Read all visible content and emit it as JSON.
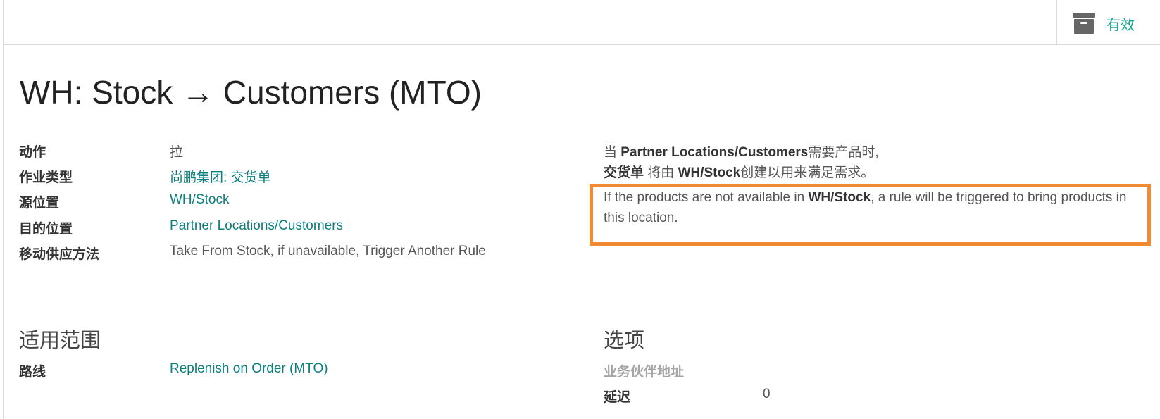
{
  "header": {
    "archive_button_label": "有效"
  },
  "record": {
    "title": "WH: Stock → Customers (MTO)"
  },
  "fields": [
    {
      "label": "动作",
      "value": "拉"
    },
    {
      "label": "作业类型",
      "value": "尚鹏集团: 交货单"
    },
    {
      "label": "源位置",
      "value": "WH/Stock"
    },
    {
      "label": "目的位置",
      "value": "Partner Locations/Customers"
    },
    {
      "label": "移动供应方法",
      "value": "Take From Stock, if unavailable, Trigger Another Rule"
    }
  ],
  "explanation": {
    "line1_prefix": "当 ",
    "line1_location": "Partner Locations/Customers",
    "line1_suffix": "需要产品时,",
    "line2_picking": "交货单",
    "line2_middle": " 将由 ",
    "line2_source": "WH/Stock",
    "line2_suffix": "创建以用来满足需求。",
    "warning_prefix": "If the products are not available in ",
    "warning_location": "WH/Stock",
    "warning_suffix": ", a rule will be triggered to bring products in this location.",
    "highlight_color": "#f08a33"
  },
  "applicability": {
    "title": "适用范围",
    "route_label": "路线",
    "route_value": "Replenish on Order (MTO)"
  },
  "options": {
    "title": "选项",
    "partner_address_label": "业务伙伴地址",
    "delay_label": "延迟",
    "delay_value": "0"
  },
  "colors": {
    "link": "#0b7e7e",
    "accent": "#17a58c"
  }
}
